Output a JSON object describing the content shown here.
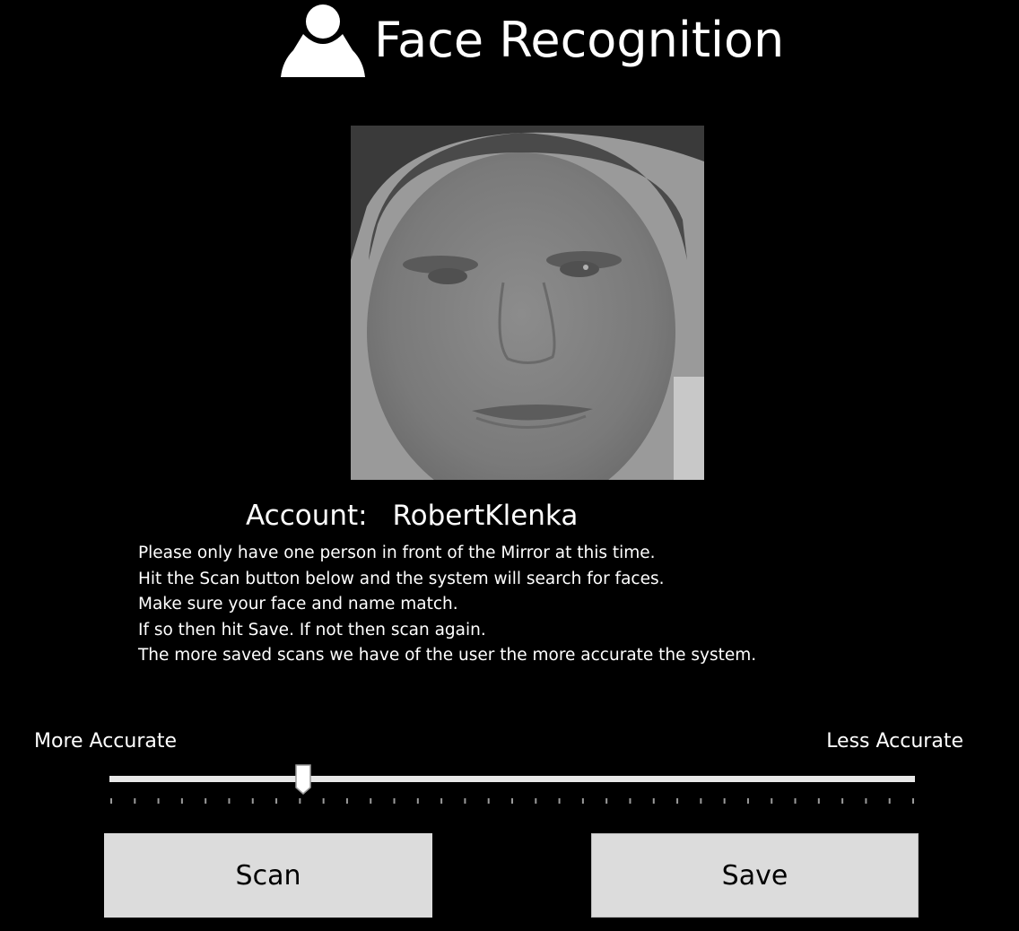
{
  "header": {
    "title": "Face Recognition",
    "icon": "user-silhouette-icon"
  },
  "account": {
    "label": "Account:",
    "name": "RobertKlenka"
  },
  "instructions": [
    "Please only have one person in front of the Mirror at this time.",
    "Hit the Scan button below and the system will search for faces.",
    "Make sure your face and name match.",
    "If so then hit Save. If not then scan again.",
    "The more saved scans we have of the user the more accurate the system."
  ],
  "slider": {
    "left_label": "More Accurate",
    "right_label": "Less Accurate",
    "value_fraction": 0.23,
    "tick_count": 35
  },
  "buttons": {
    "scan": "Scan",
    "save": "Save"
  },
  "colors": {
    "background": "#000000",
    "text": "#ffffff",
    "button_bg": "#dcdcdc",
    "track": "#e8e8e8"
  }
}
